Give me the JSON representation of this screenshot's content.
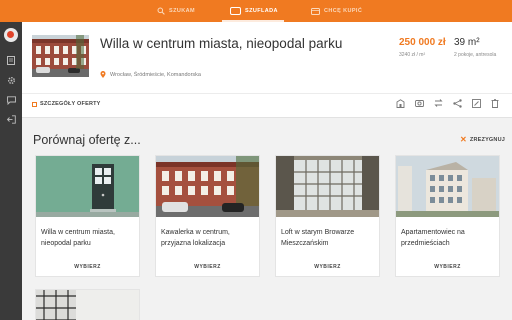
{
  "topnav": {
    "search_label": "SZUKAM",
    "drawer_label": "SZUFLADA",
    "buy_label": "CHCĘ KUPIĆ"
  },
  "listing": {
    "title": "Willa w centrum miasta, nieopodal parku",
    "address": "Wrocław, Śródmieście, Komandorska",
    "price": "250 000 zł",
    "price_per_m2": "3240 zł / m²",
    "area": "39 m²",
    "rooms": "2 pokoje, antresola"
  },
  "toolbar": {
    "details_label": "SZCZEGÓŁY OFERTY"
  },
  "compare": {
    "title": "Porównaj ofertę z...",
    "dismiss_label": "ZREZYGNUJ",
    "choose_label": "WYBIERZ",
    "cards": [
      {
        "title": "Willa w centrum miasta, nieopodal parku"
      },
      {
        "title": "Kawalerka w centrum, przyjazna lokalizacja"
      },
      {
        "title": "Loft w starym Browarze Mieszczańskim"
      },
      {
        "title": "Apartamentowiec na przedmieściach"
      }
    ]
  },
  "colors": {
    "accent": "#f07a21",
    "sidebar": "#3a3a3a",
    "background": "#f2f2f2"
  },
  "icons": [
    "search-icon",
    "drawer-icon",
    "wallet-icon",
    "app-logo-icon",
    "list-icon",
    "gear-icon",
    "chat-icon",
    "logout-icon",
    "location-pin-icon",
    "building-icon",
    "camera-icon",
    "swap-icon",
    "share-icon",
    "edit-icon",
    "trash-icon",
    "close-icon"
  ]
}
